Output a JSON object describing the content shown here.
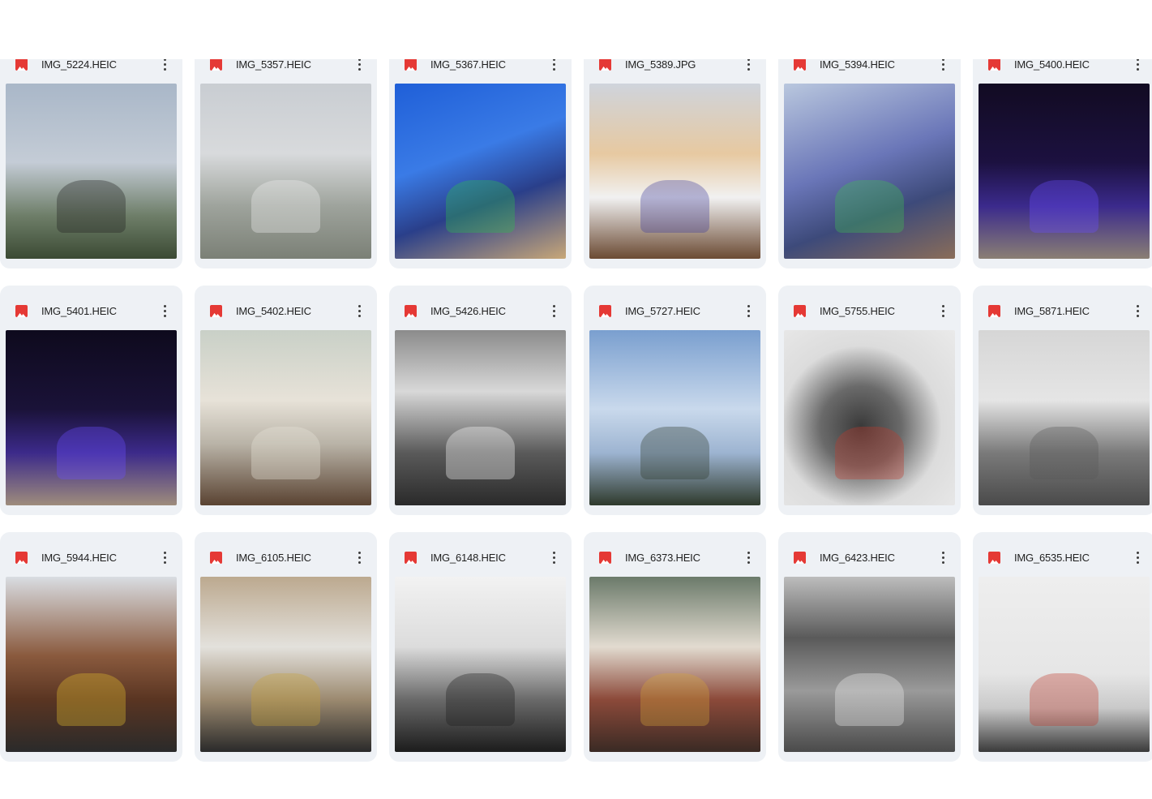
{
  "files": [
    {
      "name": "IMG_5224.HEIC",
      "thumb": "linear-gradient(180deg,#a9b7c8 0%,#c4ccd6 45%,#6f7f6a 75%,#3b4a34 100%)",
      "accent": "#1f1f1f"
    },
    {
      "name": "IMG_5357.HEIC",
      "thumb": "linear-gradient(180deg,#c9cdd2 0%,#d8dadc 40%,#9ea39c 70%,#7b8076 100%)",
      "accent": "#f2f2f2"
    },
    {
      "name": "IMG_5367.HEIC",
      "thumb": "linear-gradient(160deg,#1f5fd8 0%,#3a7be6 40%,#2a3f8a 65%,#c8a778 100%)",
      "accent": "#2fbf4a"
    },
    {
      "name": "IMG_5389.JPG",
      "thumb": "linear-gradient(180deg,#cfd4dc 0%,#e7c9a1 40%,#f1f1f1 65%,#6b4a33 100%)",
      "accent": "#3f3b9a"
    },
    {
      "name": "IMG_5394.HEIC",
      "thumb": "linear-gradient(160deg,#b9c7de 0%,#6a76b8 45%,#3d4a7a 70%,#8a6d59 100%)",
      "accent": "#3fbf50"
    },
    {
      "name": "IMG_5400.HEIC",
      "thumb": "linear-gradient(180deg,#120b22 0%,#1c1140 45%,#3b2a8c 70%,#8a7f74 100%)",
      "accent": "#6b4cff"
    },
    {
      "name": "IMG_5401.HEIC",
      "thumb": "linear-gradient(180deg,#0e0a1d 0%,#1a1238 45%,#3c2a8a 70%,#9e8c7c 100%)",
      "accent": "#6b4cff"
    },
    {
      "name": "IMG_5402.HEIC",
      "thumb": "linear-gradient(180deg,#c9d0c7 0%,#e7e2d8 40%,#b9b3a7 65%,#5a4332 100%)",
      "accent": "#e9e4da"
    },
    {
      "name": "IMG_5426.HEIC",
      "thumb": "linear-gradient(180deg,#8b8b8b 0%,#d8d8d8 35%,#5a5a5a 70%,#2a2a2a 100%)",
      "accent": "#ffffff"
    },
    {
      "name": "IMG_5727.HEIC",
      "thumb": "linear-gradient(180deg,#7a9fcf 0%,#c9d9ec 45%,#9db4d1 70%,#2f3a2c 100%)",
      "accent": "#2f3a2c"
    },
    {
      "name": "IMG_5755.HEIC",
      "thumb": "radial-gradient(circle at 45% 55%,#3a3a3a 0%,#6a6a6a 30%,#dcdcdc 60%,#eaeaea 100%)",
      "accent": "#c0392b"
    },
    {
      "name": "IMG_5871.HEIC",
      "thumb": "linear-gradient(180deg,#d6d6d6 0%,#e5e5e5 40%,#7a7a7a 70%,#4a4a4a 100%)",
      "accent": "#595959"
    },
    {
      "name": "IMG_5944.HEIC",
      "thumb": "linear-gradient(180deg,#d9dde2 0%,#8a5a3e 45%,#5a3522 70%,#2a2a2a 100%)",
      "accent": "#e6c12e"
    },
    {
      "name": "IMG_6105.HEIC",
      "thumb": "linear-gradient(180deg,#bca98f 0%,#e3e1dc 40%,#9c8a70 70%,#2a2a2a 100%)",
      "accent": "#c9a23a"
    },
    {
      "name": "IMG_6148.HEIC",
      "thumb": "linear-gradient(180deg,#f2f2f2 0%,#dcdcdc 40%,#6a6a6a 70%,#1c1c1c 100%)",
      "accent": "#1c1c1c"
    },
    {
      "name": "IMG_6373.HEIC",
      "thumb": "linear-gradient(180deg,#6b7a6a 0%,#e2dbd0 40%,#8c4a3a 70%,#3a2a24 100%)",
      "accent": "#d3a33a"
    },
    {
      "name": "IMG_6423.HEIC",
      "thumb": "linear-gradient(180deg,#bdbdbd 0%,#5a5a5a 35%,#9a9a9a 65%,#4a4a4a 100%)",
      "accent": "#f0f0f0"
    },
    {
      "name": "IMG_6535.HEIC",
      "thumb": "linear-gradient(180deg,#eeeeee 0%,#e6e6e6 55%,#c9c9c9 75%,#3a3a3a 100%)",
      "accent": "#c0392b"
    }
  ]
}
